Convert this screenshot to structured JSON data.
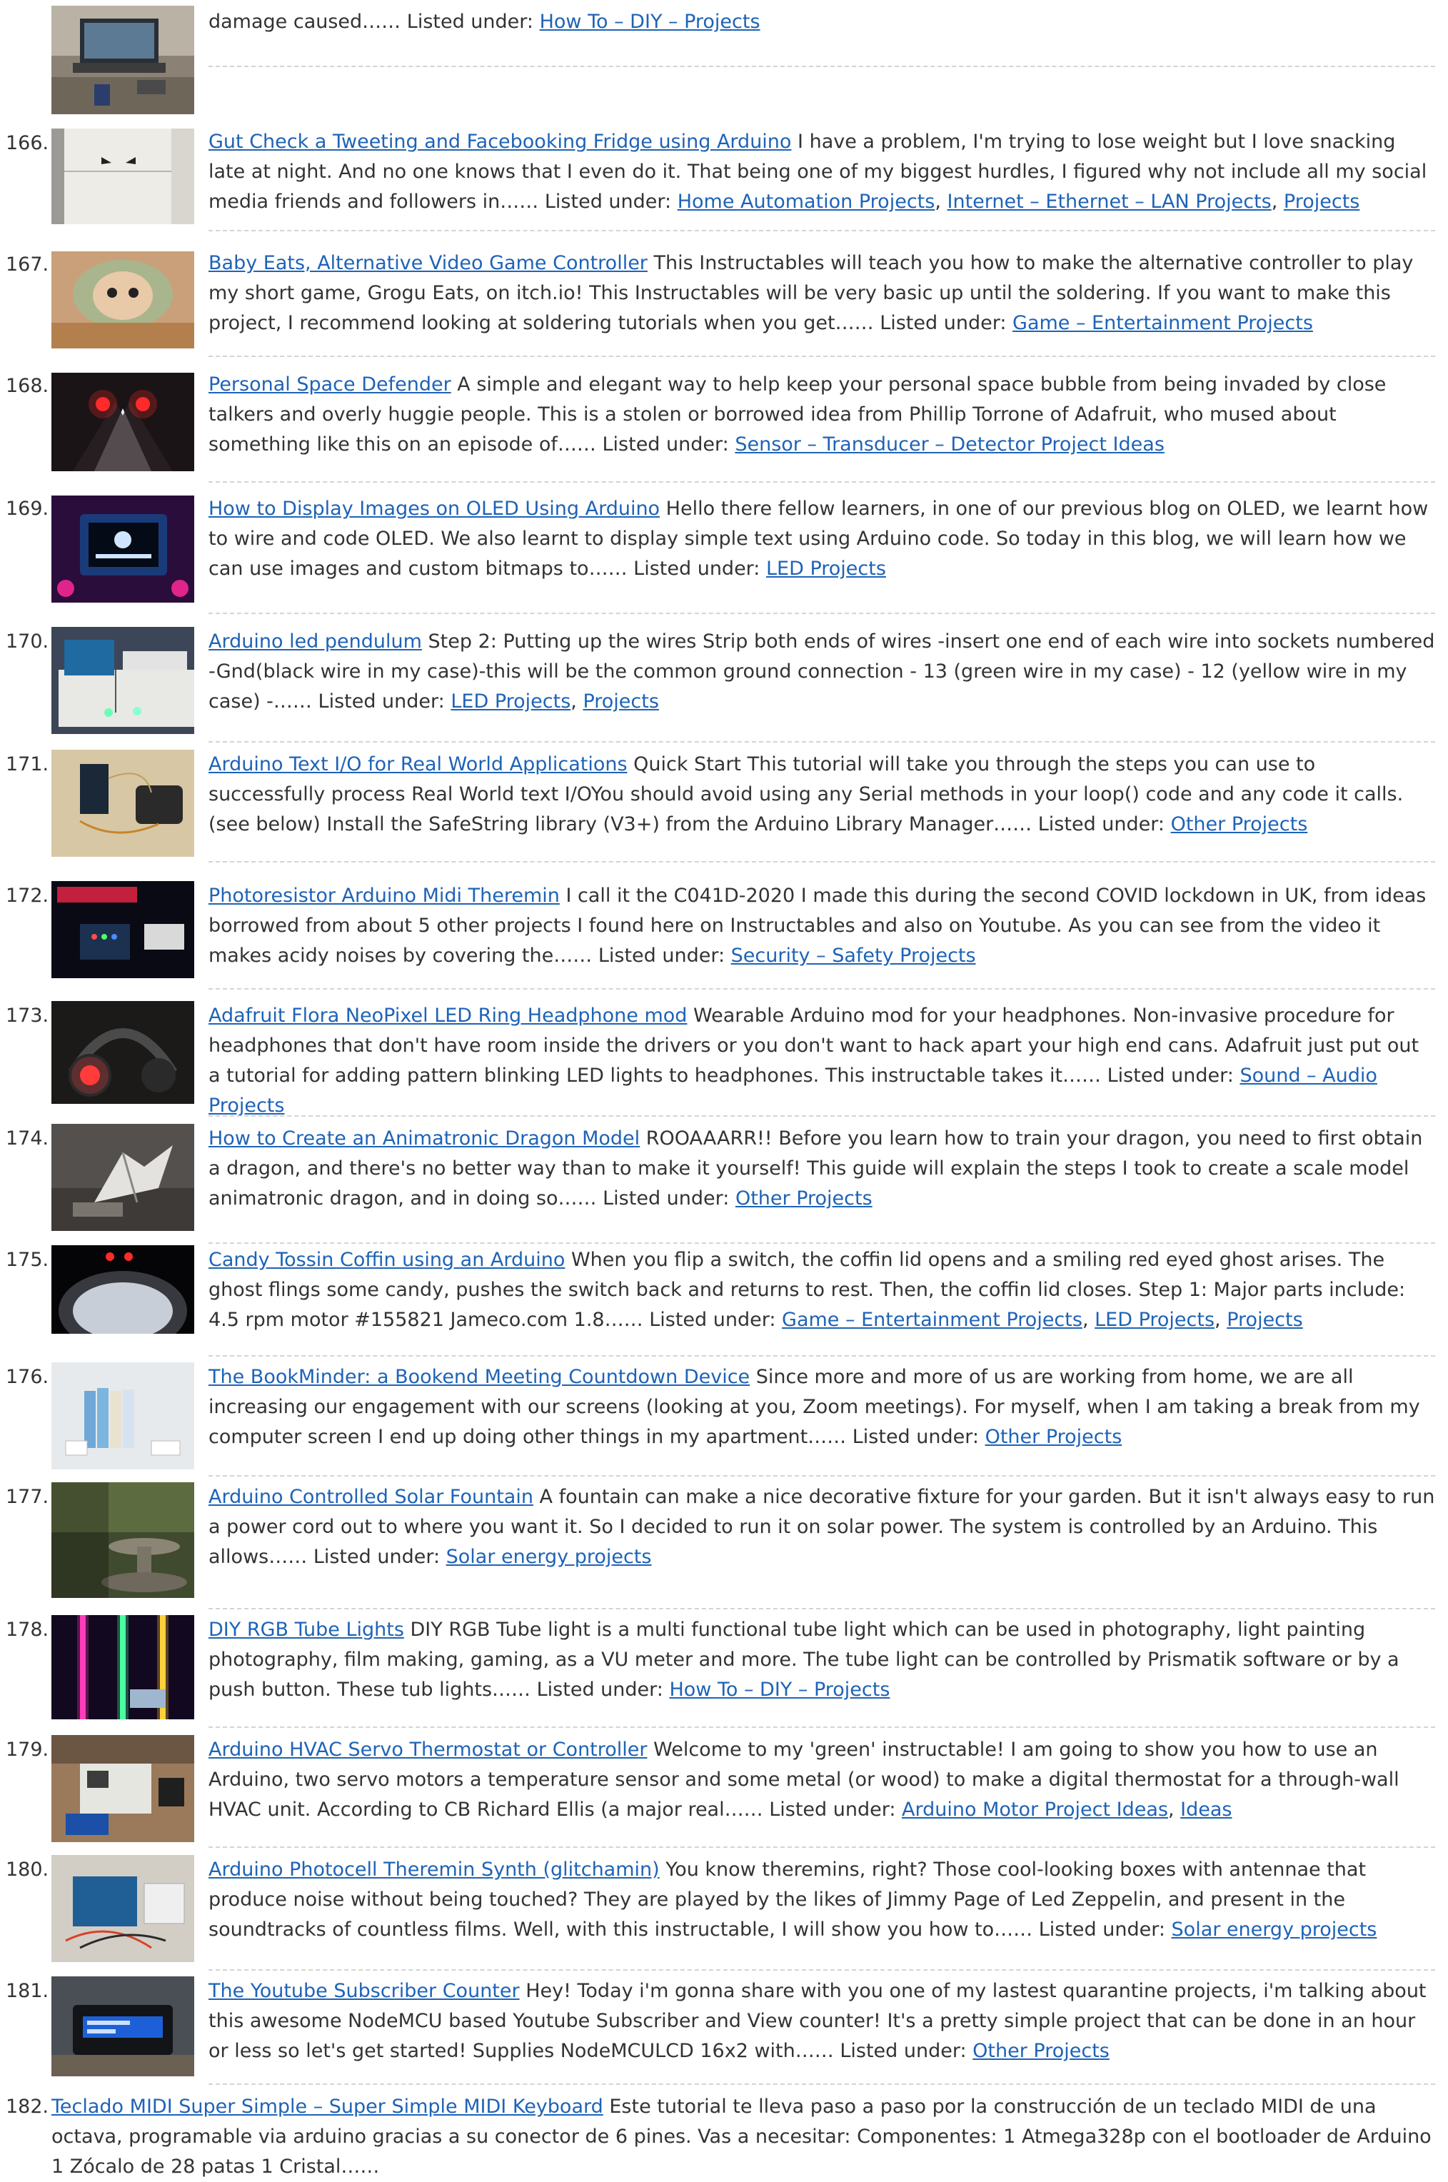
{
  "listed_under_label": "Listed under:",
  "list_separator": ",",
  "entries": [
    {
      "num": "",
      "title": "",
      "desc": "damage caused……",
      "categories": [
        "How To – DIY – Projects"
      ]
    },
    {
      "num": "166.",
      "title": "Gut Check a Tweeting and Facebooking Fridge using Arduino",
      "desc": "I have a problem, I'm trying to lose weight but I love snacking late at night. And no one knows that I even do it. That being one of my biggest hurdles, I figured why not include all my social media friends and followers in……",
      "categories": [
        "Home Automation Projects",
        "Internet – Ethernet – LAN Projects",
        "Projects"
      ]
    },
    {
      "num": "167.",
      "title": "Baby Eats, Alternative Video Game Controller",
      "desc": "This Instructables will teach you how to make the alternative controller to play my short game, Grogu Eats, on itch.io! This Instructables will be very basic up until the soldering. If you want to make this project, I recommend looking at soldering tutorials when you get……",
      "categories": [
        "Game – Entertainment Projects"
      ]
    },
    {
      "num": "168.",
      "title": "Personal Space Defender",
      "desc": "A simple and elegant way to help keep your personal space bubble from being invaded by close talkers and overly huggie people.   This is a stolen or borrowed idea from Phillip Torrone of Adafruit, who mused about something like this on an episode of……",
      "categories": [
        "Sensor – Transducer – Detector Project Ideas"
      ]
    },
    {
      "num": "169.",
      "title": "How to Display Images on OLED Using Arduino",
      "desc": "Hello there fellow learners, in one of our previous blog on OLED, we learnt how to wire and code OLED. We also learnt to display simple text using Arduino code. So today in this blog, we will learn how we can use images and custom bitmaps to……",
      "categories": [
        "LED Projects"
      ]
    },
    {
      "num": "170.",
      "title": "Arduino led pendulum",
      "desc": "Step 2: Putting up the wires Strip both ends of wires -insert one end of each wire into sockets numbered -Gnd(black wire in my case)-this will be the common ground connection - 13  (green wire in my case) - 12  (yellow wire in my case) -……",
      "categories": [
        "LED Projects",
        "Projects"
      ]
    },
    {
      "num": "171.",
      "title": "Arduino Text I/O for Real World Applications",
      "desc": "Quick Start This tutorial will take you through the steps you can use to successfully process Real World text I/OYou should avoid using any Serial methods in your loop() code and any code it calls. (see below) Install the SafeString library (V3+) from the Arduino Library Manager……",
      "categories": [
        "Other Projects"
      ]
    },
    {
      "num": "172.",
      "title": "Photoresistor Arduino Midi Theremin",
      "desc": "I call it the C041D-2020 I made this during the second COVID lockdown in UK, from ideas borrowed from about 5 other projects I found here on Instructables and also on Youtube. As you can see from the video it makes acidy noises by covering the……",
      "categories": [
        "Security – Safety Projects"
      ]
    },
    {
      "num": "173.",
      "title": "Adafruit Flora NeoPixel LED Ring Headphone mod",
      "desc": "Wearable Arduino mod for your headphones. Non-invasive procedure for headphones that don't have room inside the drivers or you don't want to hack apart your high end cans. Adafruit just put out a tutorial for adding pattern blinking LED lights to headphones.  This instructable takes it……",
      "categories": [
        "Sound – Audio Projects"
      ]
    },
    {
      "num": "174.",
      "title": "How to Create an Animatronic Dragon Model",
      "desc": "ROOAAARR!! Before you learn how to train your dragon, you need to first obtain a dragon, and there's no better way than to make it yourself! This guide will explain the steps I took to create a scale model animatronic dragon, and in doing so……",
      "categories": [
        "Other Projects"
      ]
    },
    {
      "num": "175.",
      "title": "Candy Tossin Coffin using an Arduino",
      "desc": "When you flip a switch, the coffin lid opens and a smiling red eyed ghost arises. The ghost flings some candy, pushes the switch back and returns to rest. Then, the coffin lid closes. Step 1: Major parts include: 4.5 rpm motor  #155821 Jameco.com 1.8……",
      "categories": [
        "Game – Entertainment Projects",
        "LED Projects",
        "Projects"
      ]
    },
    {
      "num": "176.",
      "title": "The BookMinder: a Bookend Meeting Countdown Device",
      "desc": "Since more and more of us are working from home, we are all increasing our engagement with our screens (looking at you, Zoom meetings). For myself, when I am taking a break from my computer screen I end up doing other things in my apartment……",
      "categories": [
        "Other Projects"
      ]
    },
    {
      "num": "177.",
      "title": "Arduino Controlled Solar Fountain",
      "desc": "A fountain can make a nice decorative fixture for your garden. But it isn't always easy to run a power cord out to where you want it. So I decided to run it on solar power. The system is controlled by an Arduino. This allows……",
      "categories": [
        "Solar energy projects"
      ]
    },
    {
      "num": "178.",
      "title": "DIY RGB Tube Lights",
      "desc": "DIY RGB Tube light is a multi functional tube light which can be used in photography, light painting photography, film making, gaming, as a VU meter and more. The tube light can be controlled by Prismatik software or by a push button. These tub lights……",
      "categories": [
        "How To – DIY – Projects"
      ]
    },
    {
      "num": "179.",
      "title": "Arduino HVAC Servo Thermostat or Controller",
      "desc": "Welcome to my 'green' instructable! I am going to show you how to use an Arduino, two servo motors a temperature sensor and some metal (or wood) to make a digital thermostat for a through-wall HVAC unit. According to CB Richard Ellis (a major real……",
      "categories": [
        "Arduino Motor Project Ideas",
        "Ideas"
      ]
    },
    {
      "num": "180.",
      "title": "Arduino Photocell Theremin Synth (glitchamin)",
      "desc": "You know theremins, right?  Those cool-looking boxes with antennae that produce noise without being touched?  They are played by the likes of Jimmy Page of Led Zeppelin, and present in the soundtracks of countless films.  Well, with this instructable, I will show you how to……",
      "categories": [
        "Solar energy projects"
      ]
    },
    {
      "num": "181.",
      "title": "The Youtube Subscriber Counter",
      "desc": "Hey! Today i'm gonna share with you one of my lastest quarantine projects, i'm talking about this awesome NodeMCU based Youtube Subscriber and View counter! It's a pretty simple project that can be done in an hour or less so let's get started! Supplies NodeMCULCD 16x2 with……",
      "categories": [
        "Other Projects"
      ]
    },
    {
      "num": "182.",
      "title": "Teclado MIDI Super Simple – Super Simple MIDI Keyboard",
      "desc": "Este tutorial te lleva paso a paso por la construcción de un teclado MIDI de una octava, programable via arduino gracias a su conector de 6 pines. Vas a necesitar: Componentes: 1 Atmega328p con el bootloader de Arduino 1 Zócalo de 28 patas 1 Cristal……",
      "categories": []
    }
  ]
}
